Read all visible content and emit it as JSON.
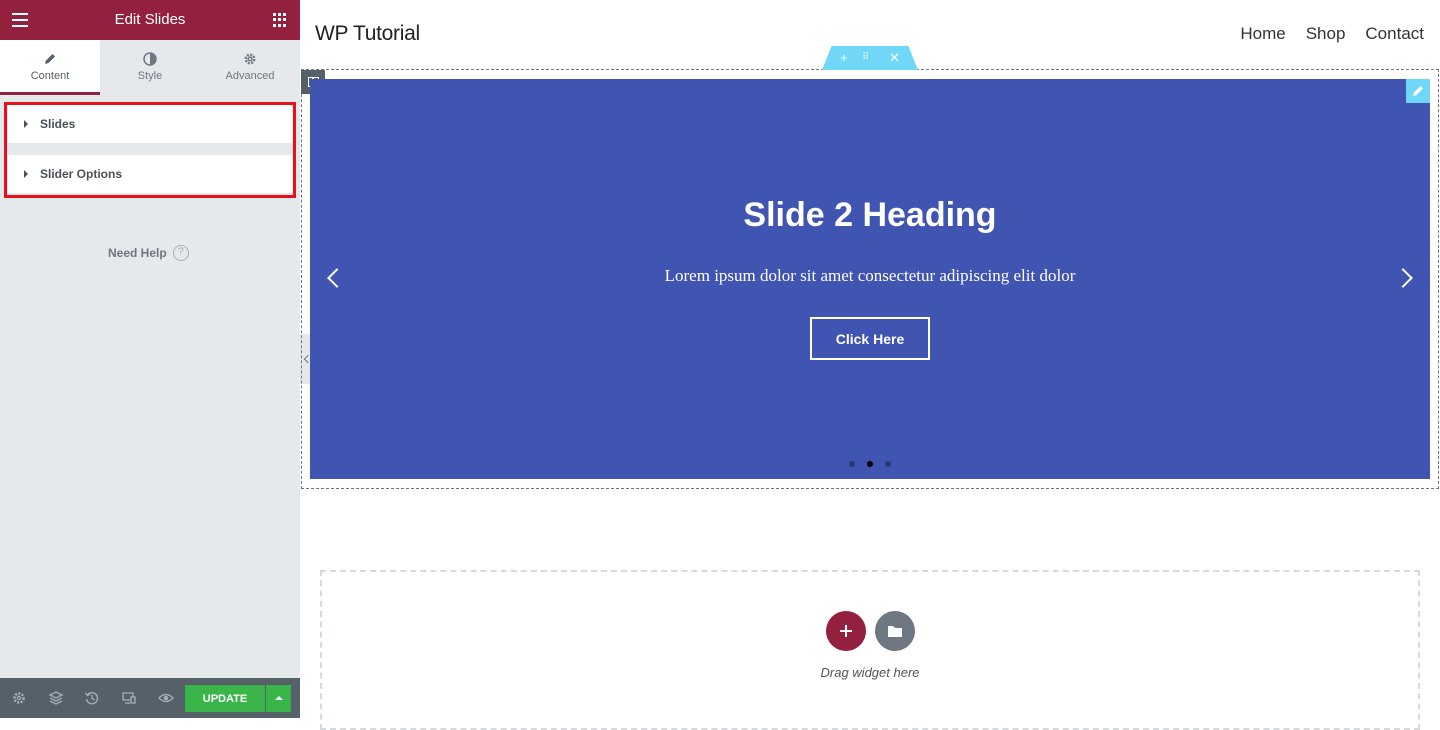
{
  "panel": {
    "title": "Edit Slides",
    "tabs": [
      {
        "label": "Content",
        "icon": "pencil-icon",
        "active": true
      },
      {
        "label": "Style",
        "icon": "half-circle-icon",
        "active": false
      },
      {
        "label": "Advanced",
        "icon": "gear-icon",
        "active": false
      }
    ],
    "sections": [
      {
        "label": "Slides"
      },
      {
        "label": "Slider Options"
      }
    ],
    "help": {
      "label": "Need Help",
      "icon": "question-icon"
    },
    "footer": {
      "icons": [
        "settings-icon",
        "layers-icon",
        "history-icon",
        "responsive-icon",
        "preview-eye-icon"
      ],
      "update_label": "UPDATE"
    },
    "accent_color": "#93203e",
    "update_color": "#39b54a",
    "highlight_color": "#e8101b"
  },
  "site": {
    "title": "WP Tutorial",
    "nav": [
      "Home",
      "Shop",
      "Contact"
    ]
  },
  "slider": {
    "heading": "Slide 2 Heading",
    "description": "Lorem ipsum dolor sit amet consectetur adipiscing elit dolor",
    "button_label": "Click Here",
    "background": "#4054b2",
    "slide_count": 3,
    "active_slide": 2
  },
  "drop_zone": {
    "text": "Drag widget here"
  }
}
